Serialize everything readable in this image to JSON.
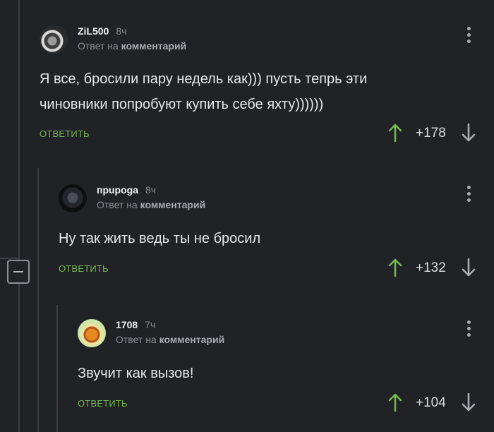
{
  "comments": [
    {
      "author": "ZiL500",
      "time": "8ч",
      "reply_prefix": "Ответ на",
      "reply_target": "комментарий",
      "lines": [
        "Я все, бросили пару недель как))) пусть тепрь эти",
        "чиновники попробуют купить себе яхту))))))"
      ],
      "reply_label": "ОТВЕТИТЬ",
      "score": "+178"
    },
    {
      "author": "прuрoga",
      "time": "8ч",
      "reply_prefix": "Ответ на",
      "reply_target": "комментарий",
      "lines": [
        "Ну так жить ведь ты не бросил"
      ],
      "reply_label": "ОТВЕТИТЬ",
      "score": "+132"
    },
    {
      "author": "1708",
      "time": "7ч",
      "reply_prefix": "Ответ на",
      "reply_target": "комментарий",
      "lines": [
        "Звучит как вызов!"
      ],
      "reply_label": "ОТВЕТИТЬ",
      "score": "+104"
    }
  ],
  "icons": {
    "upvote": "arrow-up-icon",
    "downvote": "arrow-down-icon",
    "more": "more-vertical-icon",
    "collapse": "collapse-minus-icon"
  },
  "colors": {
    "background": "#202226",
    "upvote": "#74b84f",
    "reply": "#74b84f",
    "text": "#e6e7e9",
    "muted": "#8a8d91"
  }
}
